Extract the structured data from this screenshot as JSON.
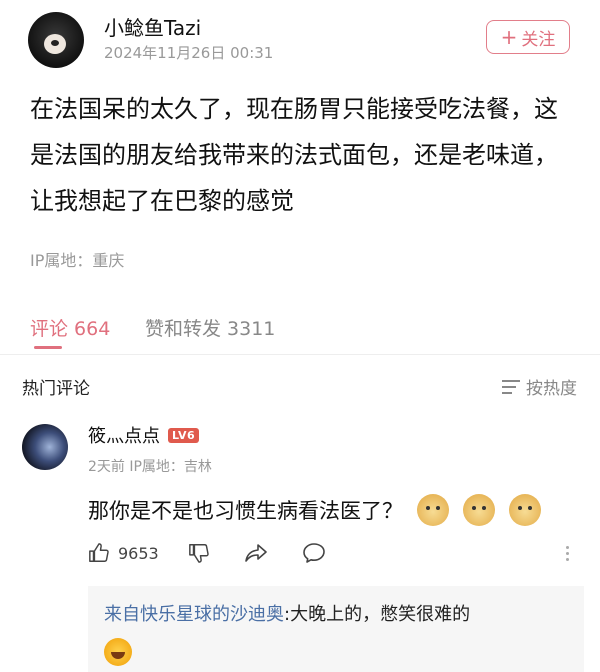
{
  "post": {
    "author": "小鲶鱼Tazi",
    "time": "2024年11月26日 00:31",
    "follow_label": "关注",
    "body": "在法国呆的太久了，现在肠胃只能接受吃法餐，这是法国的朋友给我带来的法式面包，还是老味道，让我想起了在巴黎的感觉",
    "ip": "IP属地：重庆"
  },
  "tabs": {
    "comments": "评论 664",
    "reposts": "赞和转发 3311"
  },
  "comments_section": {
    "title": "热门评论",
    "sort_label": "按热度"
  },
  "comment": {
    "user": "筱灬点点",
    "level": "LV6",
    "meta": "2天前 IP属地：吉林",
    "text": "那你是不是也习惯生病看法医了？",
    "likes": "9653",
    "reply": {
      "user": "来自快乐星球的沙迪奥",
      "text": ":大晚上的，憋笑很难的"
    }
  },
  "colors": {
    "accent": "#e0707e",
    "link": "#4a6fa5",
    "muted": "#999999"
  }
}
